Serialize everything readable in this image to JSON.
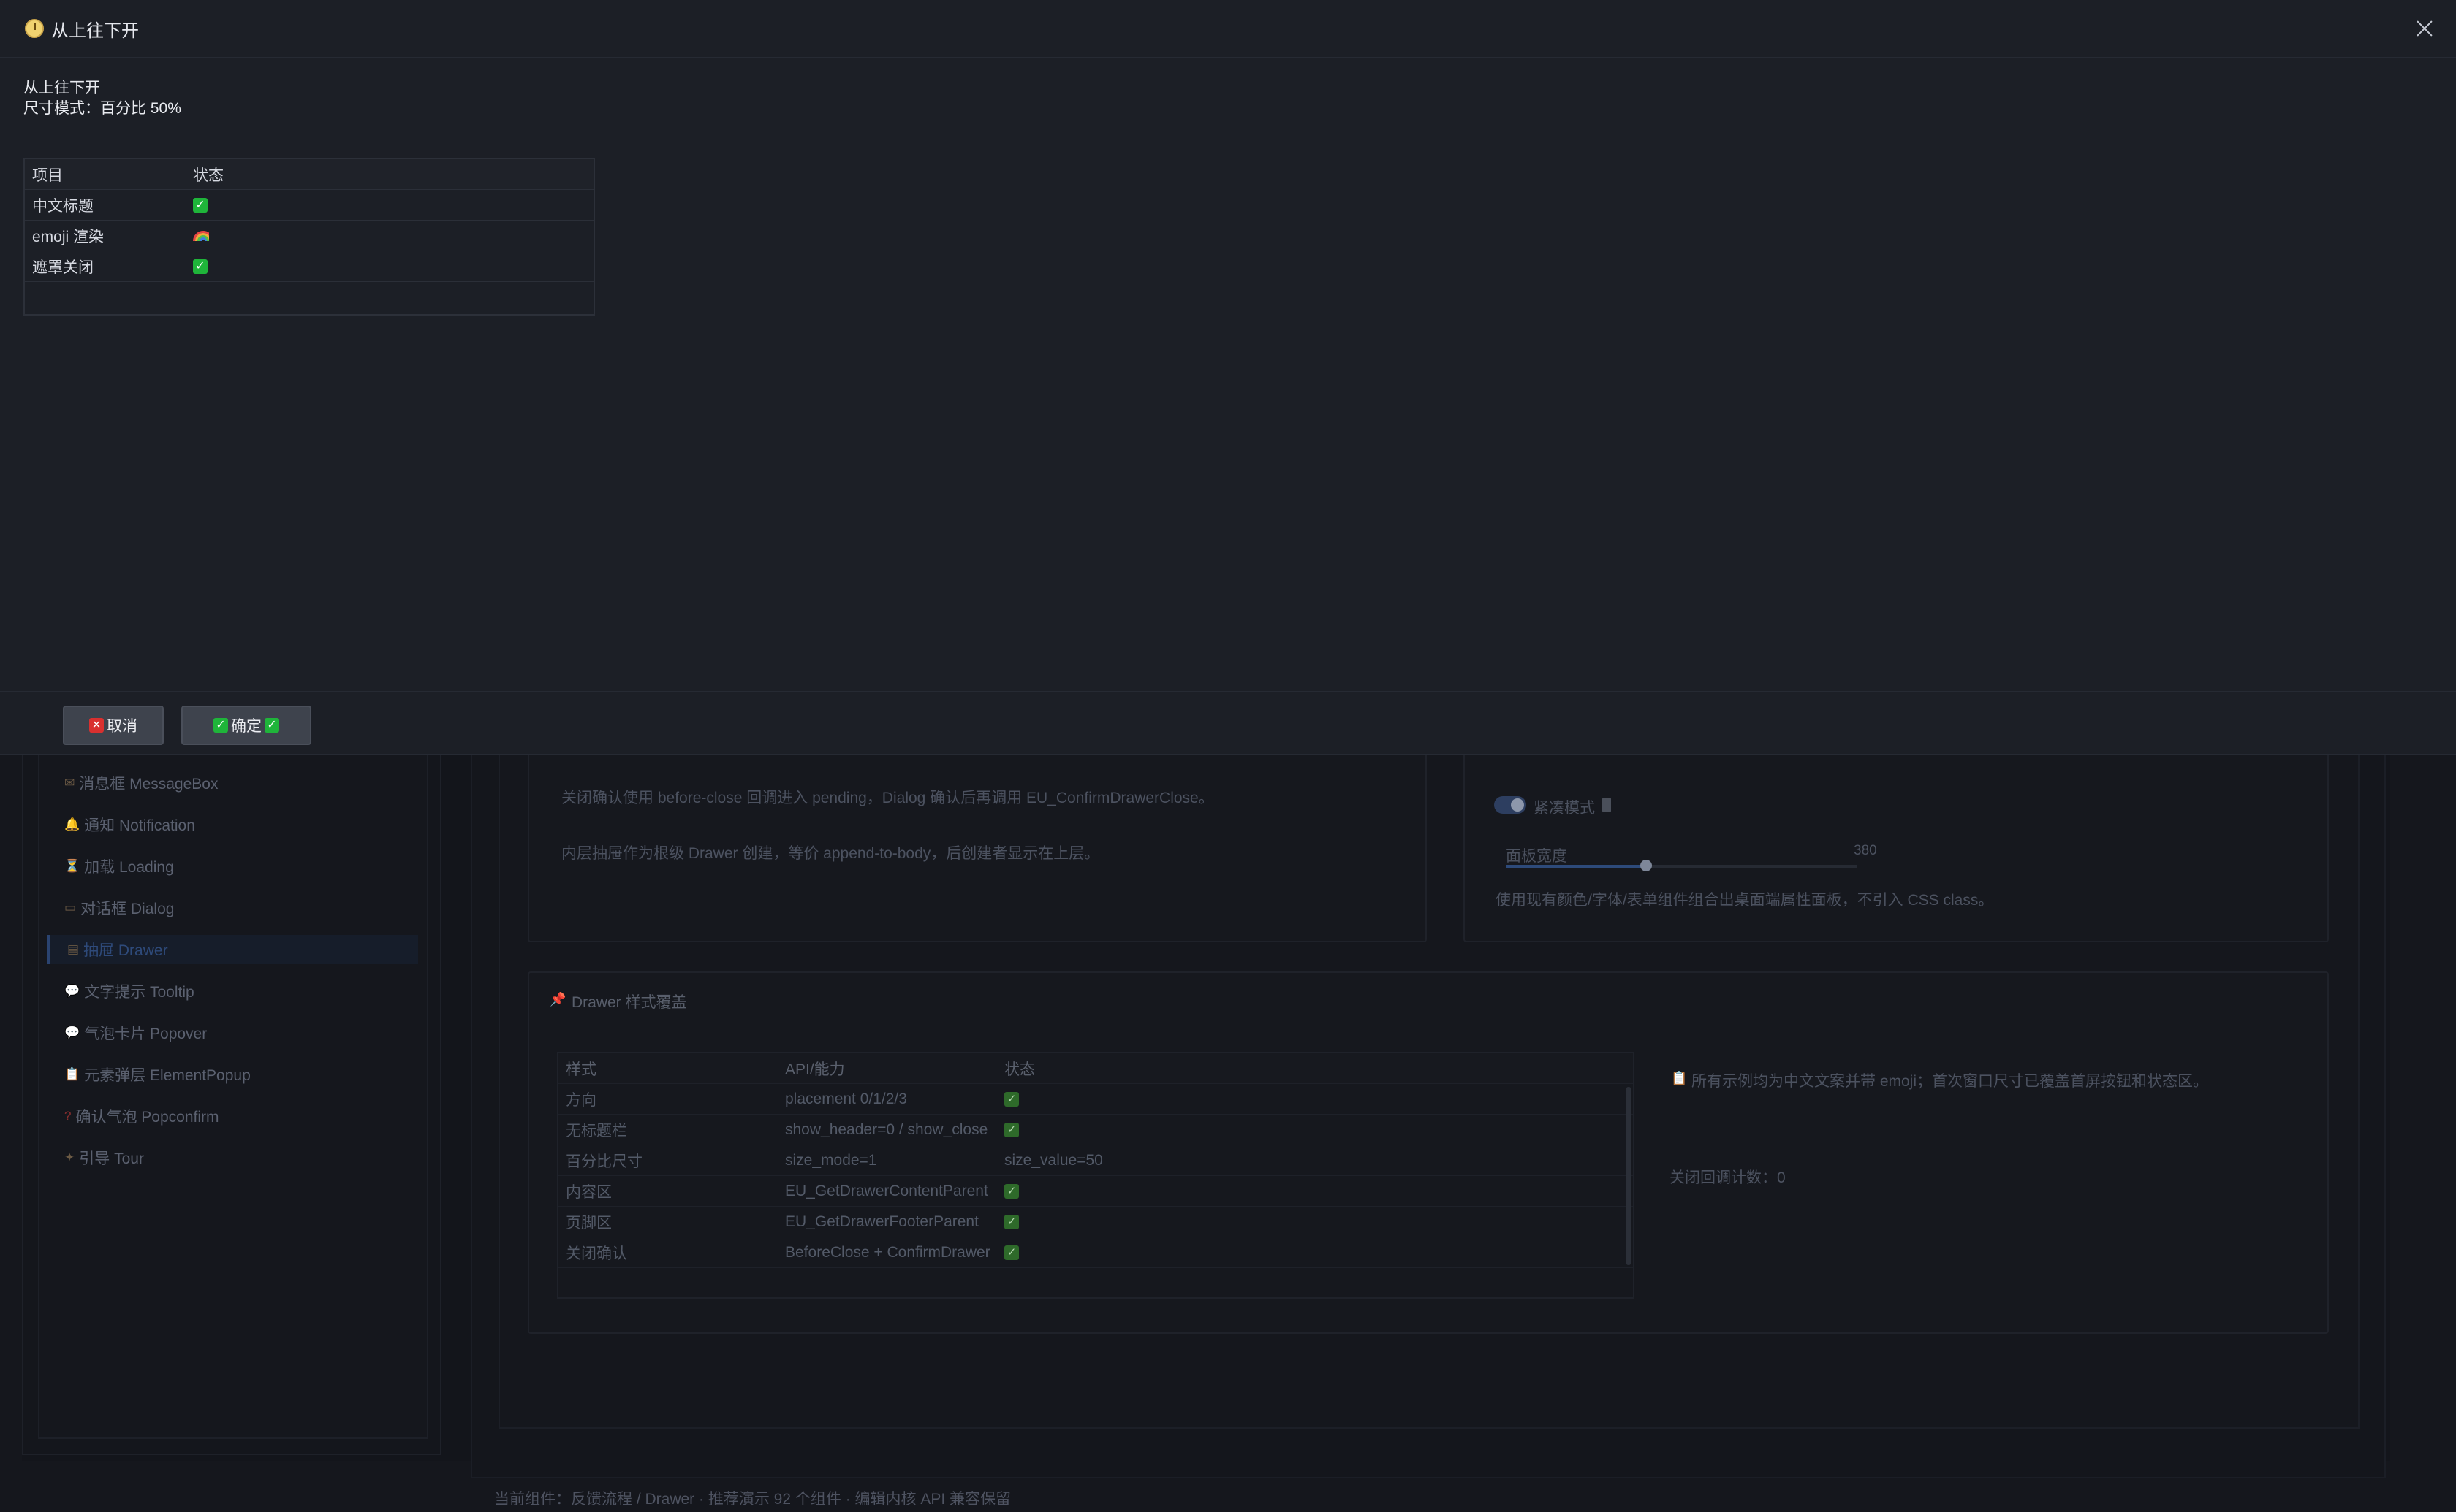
{
  "drawer": {
    "title": "从上往下开",
    "line1": "从上往下开",
    "line2": "尺寸模式：百分比 50%",
    "table": {
      "headers": [
        "项目",
        "状态"
      ],
      "rows": [
        {
          "item": "中文标题",
          "status": "check"
        },
        {
          "item": "emoji 渲染",
          "status": "rainbow"
        },
        {
          "item": "遮罩关闭",
          "status": "check"
        }
      ]
    },
    "cancel_label": "取消",
    "confirm_label": "确定"
  },
  "sidebar": {
    "items": [
      {
        "icon": "envelope-icon",
        "label": "消息框 MessageBox"
      },
      {
        "icon": "bell-icon",
        "label": "通知 Notification"
      },
      {
        "icon": "hourglass-icon",
        "label": "加载 Loading"
      },
      {
        "icon": "dialog-icon",
        "label": "对话框 Dialog"
      },
      {
        "icon": "drawer-icon",
        "label": "抽屉 Drawer",
        "active": true
      },
      {
        "icon": "speech-bubble-icon",
        "label": "文字提示 Tooltip"
      },
      {
        "icon": "speech-bubble-icon",
        "label": "气泡卡片 Popover"
      },
      {
        "icon": "clipboard-icon",
        "label": "元素弹层 ElementPopup"
      },
      {
        "icon": "question-icon",
        "label": "确认气泡 Popconfirm"
      },
      {
        "icon": "compass-icon",
        "label": "引导 Tour"
      }
    ]
  },
  "left_card": {
    "text1": "关闭确认使用 before-close 回调进入 pending，Dialog 确认后再调用 EU_ConfirmDrawerClose。",
    "text2": "内层抽屉作为根级 Drawer 创建，等价 append-to-body，后创建者显示在上层。"
  },
  "right_card": {
    "compact_label": "紧凑模式",
    "width_label": "面板宽度",
    "width_value": "380",
    "slider_fraction": 0.4,
    "desc": "使用现有颜色/字体/表单组件组合出桌面端属性面板，不引入 CSS class。"
  },
  "style_card": {
    "title": "Drawer 样式覆盖",
    "headers": [
      "样式",
      "API/能力",
      "状态"
    ],
    "rows": [
      {
        "style": "方向",
        "api": "placement 0/1/2/3",
        "status": "check"
      },
      {
        "style": "无标题栏",
        "api": "show_header=0 / show_close",
        "status": "check"
      },
      {
        "style": "百分比尺寸",
        "api": "size_mode=1",
        "status": "size_value=50"
      },
      {
        "style": "内容区",
        "api": "EU_GetDrawerContentParent",
        "status": "check"
      },
      {
        "style": "页脚区",
        "api": "EU_GetDrawerFooterParent",
        "status": "check"
      },
      {
        "style": "关闭确认",
        "api": "BeforeClose + ConfirmDrawer",
        "status": "check"
      }
    ],
    "note": "所有示例均为中文文案并带 emoji；首次窗口尺寸已覆盖首屏按钮和状态区。",
    "counter": "关闭回调计数：0"
  },
  "status_bar": "当前组件：反馈流程 / Drawer · 推荐演示 92 个组件 · 编辑内核 API 兼容保留"
}
